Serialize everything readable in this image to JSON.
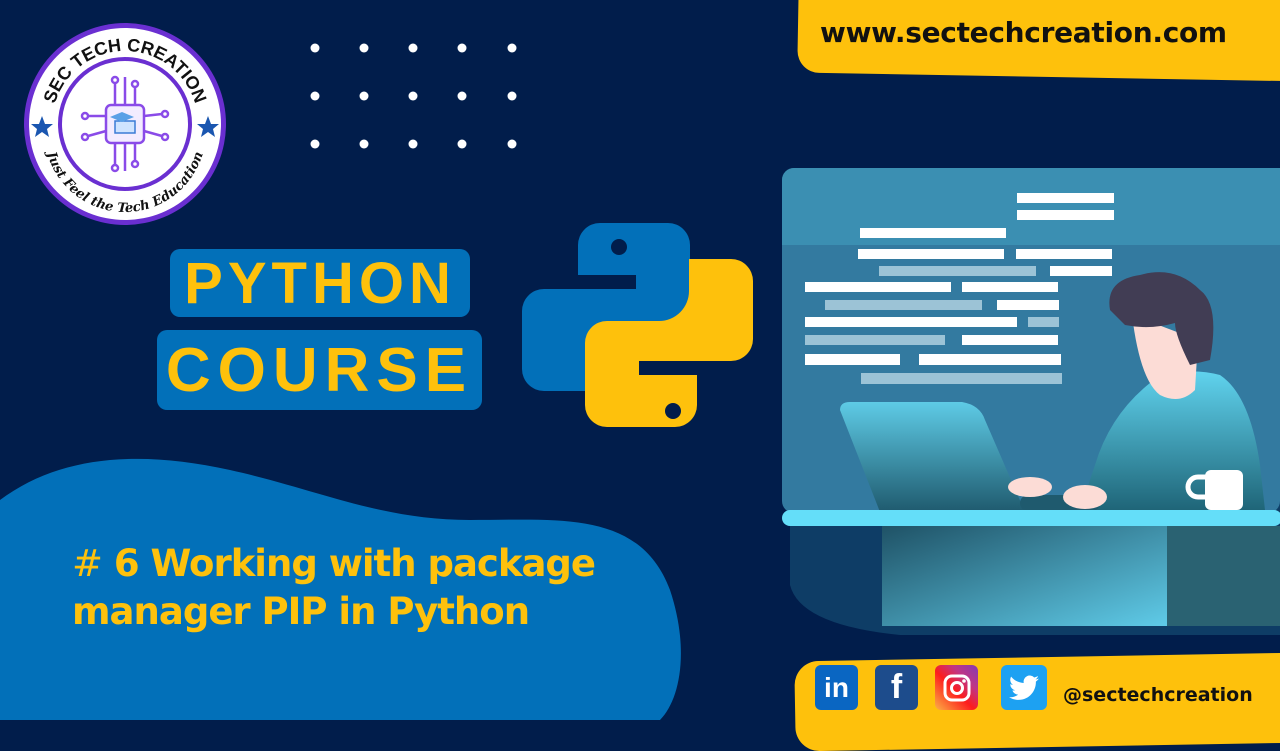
{
  "brand": {
    "logo_ring_text": "SEC TECH CREATION",
    "logo_tagline": "Just Feel the Tech Education",
    "logo_icon": "circuit-chip-laptop-icon"
  },
  "header": {
    "website_url": "www.sectechcreation.com"
  },
  "course": {
    "title_line1": "PYTHON",
    "title_line2": "COURSE",
    "logo_icon": "python-logo-icon"
  },
  "episode": {
    "hash": "#",
    "line1": "6 Working with package",
    "line2": "manager PIP in Python"
  },
  "social": {
    "icons": [
      "linkedin-icon",
      "facebook-icon",
      "instagram-icon",
      "twitter-icon"
    ],
    "linkedin_label": "in",
    "facebook_label": "f",
    "handle": "@sectechcreation"
  },
  "illustration": {
    "description": "person-working-on-laptop-with-code-screen"
  },
  "colors": {
    "background": "#011d4b",
    "accent_blue": "#0270b9",
    "accent_yellow": "#fec10c"
  }
}
